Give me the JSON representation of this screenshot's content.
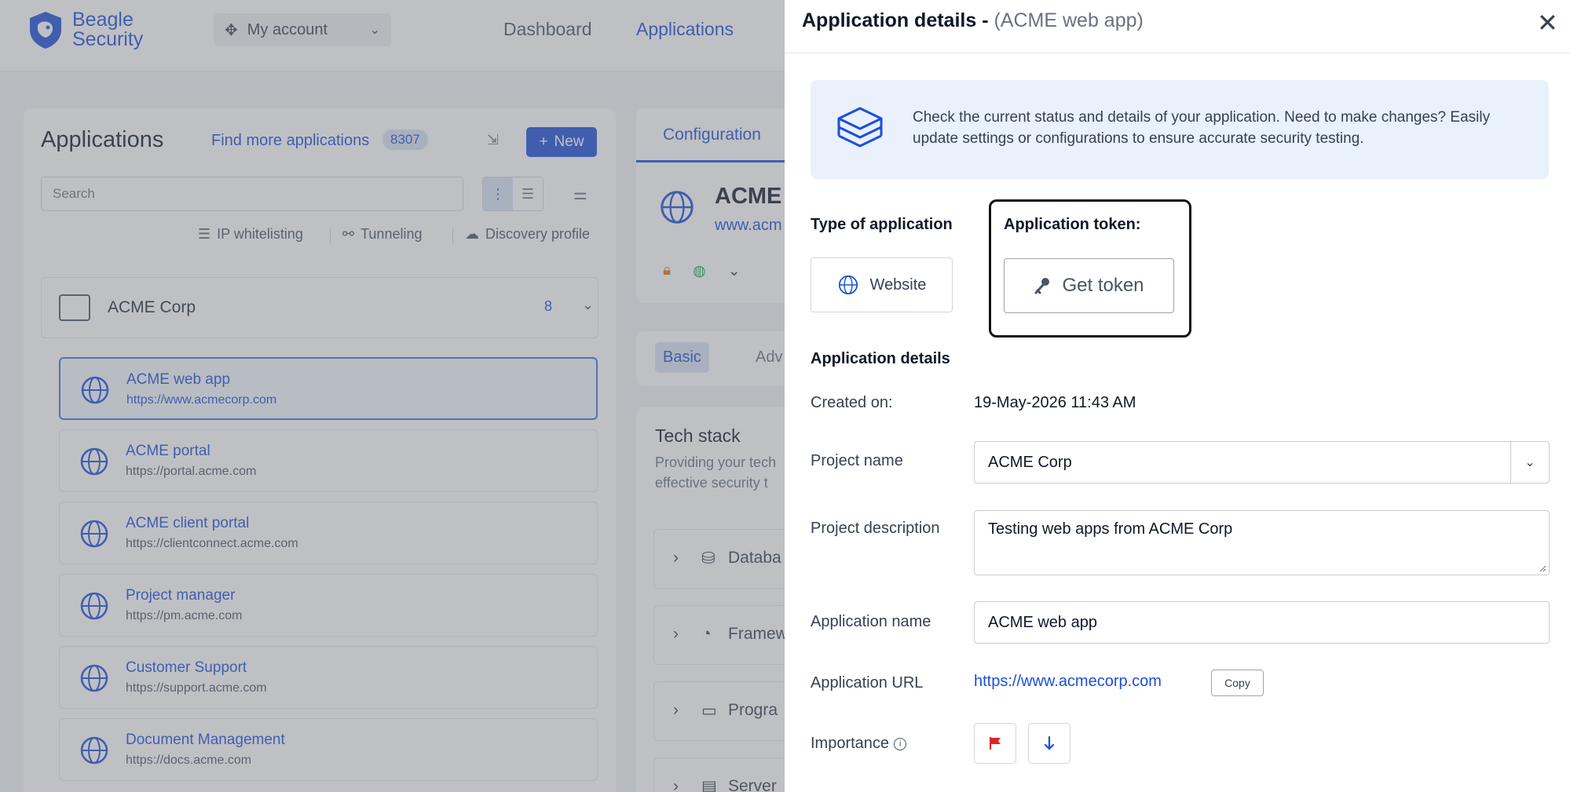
{
  "topbar": {
    "logo_line1": "Beagle",
    "logo_line2": "Security",
    "account_label": "My account",
    "nav": [
      "Dashboard",
      "Applications"
    ]
  },
  "apps_panel": {
    "title": "Applications",
    "find_more": "Find more applications",
    "count": "8307",
    "new_label": "New",
    "search_placeholder": "Search",
    "tools": [
      "IP whitelisting",
      "Tunneling",
      "Discovery profile"
    ],
    "group": {
      "name": "ACME Corp",
      "count": "8"
    },
    "items": [
      {
        "name": "ACME web app",
        "url": "https://www.acmecorp.com",
        "selected": true
      },
      {
        "name": "ACME portal",
        "url": "https://portal.acme.com"
      },
      {
        "name": "ACME client portal",
        "url": "https://clientconnect.acme.com"
      },
      {
        "name": "Project manager",
        "url": "https://pm.acme.com"
      },
      {
        "name": "Customer Support",
        "url": "https://support.acme.com"
      },
      {
        "name": "Document Management",
        "url": "https://docs.acme.com"
      }
    ]
  },
  "config_panel": {
    "tab": "Configuration",
    "app_name": "ACME",
    "app_url": "www.acm",
    "tabs": [
      "Basic",
      "Adv"
    ],
    "tech_title": "Tech stack",
    "tech_desc": "Providing your tech effective security t",
    "tech_rows": [
      "Databa",
      "Framew",
      "Progra",
      "Server"
    ]
  },
  "drawer": {
    "title": "Application details - ",
    "title_sub": "(ACME web app)",
    "info_text": "Check the current status and details of your application. Need to make changes? Easily update settings or configurations to ensure accurate security testing.",
    "type_label": "Type of application",
    "type_value": "Website",
    "token_label": "Application token:",
    "token_button": "Get token",
    "details_heading": "Application details",
    "created_label": "Created on:",
    "created_value": "19-May-2026 11:43 AM",
    "project_name_label": "Project name",
    "project_name_value": "ACME Corp",
    "project_desc_label": "Project description",
    "project_desc_value": "Testing web apps from ACME Corp",
    "app_name_label": "Application name",
    "app_name_value": "ACME web app",
    "app_url_label": "Application URL",
    "app_url_value": "https://www.acmecorp.com",
    "copy_label": "Copy",
    "importance_label": "Importance"
  },
  "colors": {
    "brand": "#1d4ed8",
    "flag": "#dc2626",
    "info_bg": "#e8f1fc"
  }
}
